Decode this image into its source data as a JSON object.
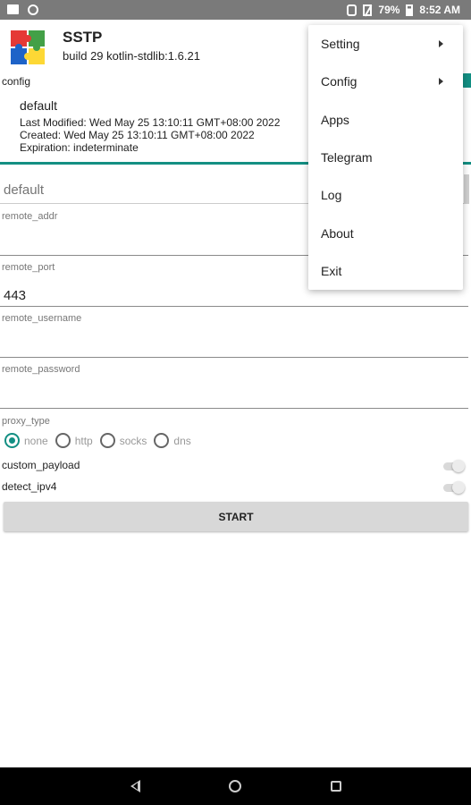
{
  "statusbar": {
    "battery": "79%",
    "time": "8:52 AM"
  },
  "app": {
    "title": "SSTP",
    "build": "build 29 kotlin-stdlib:1.6.21"
  },
  "config": {
    "label": "config",
    "profile_name": "default",
    "last_modified": "Last Modified: Wed May 25 13:10:11 GMT+08:00 2022",
    "created": "Created: Wed May 25 13:10:11 GMT+08:00 2022",
    "expiration": "Expiration: indeterminate"
  },
  "form": {
    "name_placeholder": "default",
    "remote_addr": {
      "label": "remote_addr",
      "value": ""
    },
    "remote_port": {
      "label": "remote_port",
      "value": "443"
    },
    "remote_username": {
      "label": "remote_username",
      "value": ""
    },
    "remote_password": {
      "label": "remote_password",
      "value": ""
    },
    "proxy_type": {
      "label": "proxy_type",
      "options": [
        "none",
        "http",
        "socks",
        "dns"
      ],
      "selected": "none"
    },
    "custom_payload": {
      "label": "custom_payload",
      "enabled": false
    },
    "detect_ipv4": {
      "label": "detect_ipv4",
      "enabled": false
    },
    "start_label": "START"
  },
  "menu": {
    "items": [
      {
        "label": "Setting",
        "submenu": true
      },
      {
        "label": "Config",
        "submenu": true
      },
      {
        "label": "Apps"
      },
      {
        "label": "Telegram"
      },
      {
        "label": "Log"
      },
      {
        "label": "About"
      },
      {
        "label": "Exit"
      }
    ]
  },
  "colors": {
    "accent": "#138f83",
    "statusbar": "#7a7a7a",
    "navbar": "#000000"
  },
  "icons": {
    "logo": "sstp-logo-icon",
    "back": "back-icon",
    "home": "home-icon",
    "recents": "recents-icon"
  }
}
